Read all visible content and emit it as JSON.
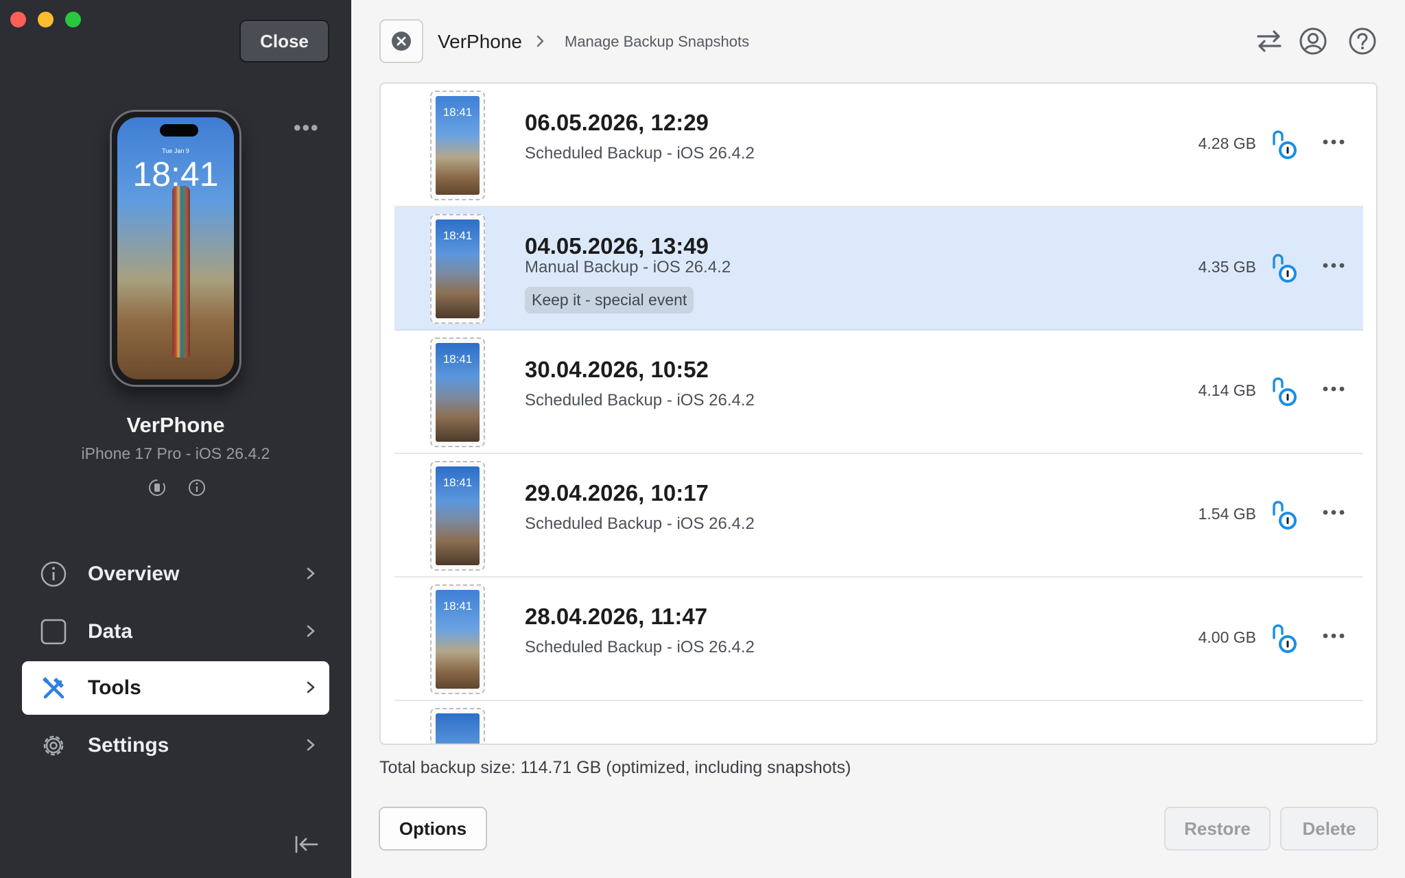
{
  "sidebar": {
    "close_label": "Close",
    "device": {
      "name": "VerPhone",
      "subtitle": "iPhone 17 Pro - iOS 26.4.2",
      "screen_time": "18:41",
      "screen_date": "Tue Jan 9"
    },
    "nav": [
      {
        "label": "Overview",
        "icon": "info-circle-icon"
      },
      {
        "label": "Data",
        "icon": "square-icon"
      },
      {
        "label": "Tools",
        "icon": "tools-icon",
        "active": true
      },
      {
        "label": "Settings",
        "icon": "gear-icon"
      }
    ]
  },
  "header": {
    "device": "VerPhone",
    "page": "Manage Backup Snapshots"
  },
  "snapshots": [
    {
      "date": "06.05.2026, 12:29",
      "type": "Scheduled Backup - iOS 26.4.2",
      "size": "4.28 GB",
      "thumb_time": "18:41"
    },
    {
      "date": "04.05.2026, 13:49",
      "type": "Manual Backup - iOS 26.4.2",
      "tag": "Keep it - special event",
      "size": "4.35 GB",
      "thumb_time": "18:41",
      "selected": true
    },
    {
      "date": "30.04.2026, 10:52",
      "type": "Scheduled Backup - iOS 26.4.2",
      "size": "4.14 GB",
      "thumb_time": "18:41"
    },
    {
      "date": "29.04.2026, 10:17",
      "type": "Scheduled Backup - iOS 26.4.2",
      "size": "1.54 GB",
      "thumb_time": "18:41"
    },
    {
      "date": "28.04.2026, 11:47",
      "type": "Scheduled Backup - iOS 26.4.2",
      "size": "4.00 GB",
      "thumb_time": "18:41"
    }
  ],
  "footer": {
    "total": "Total backup size: 114.71 GB (optimized, including snapshots)",
    "options_label": "Options",
    "restore_label": "Restore",
    "delete_label": "Delete"
  },
  "colors": {
    "sidebar_bg": "#2c2e33",
    "accent_blue": "#1a8fe3",
    "selected_row": "#dce9fa",
    "tools_icon": "#2f7fe0"
  }
}
